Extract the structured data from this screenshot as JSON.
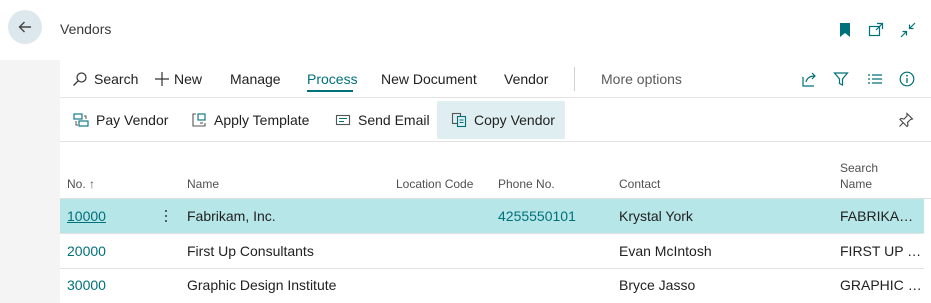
{
  "header": {
    "title": "Vendors"
  },
  "actionbar": {
    "search": "Search",
    "new": "New",
    "manage": "Manage",
    "process": "Process",
    "new_document": "New Document",
    "vendor": "Vendor",
    "more_options": "More options"
  },
  "subbar": {
    "pay_vendor": "Pay Vendor",
    "apply_template": "Apply Template",
    "send_email": "Send Email",
    "copy_vendor": "Copy Vendor"
  },
  "table": {
    "columns": {
      "no": "No. ↑",
      "name": "Name",
      "location_code": "Location Code",
      "phone": "Phone No.",
      "contact": "Contact",
      "search_name_1": "Search",
      "search_name_2": "Name"
    },
    "rows": [
      {
        "no": "10000",
        "name": "Fabrikam, Inc.",
        "location": "",
        "phone": "4255550101",
        "contact": "Krystal York",
        "search": "FABRIKAM, ..."
      },
      {
        "no": "20000",
        "name": "First Up Consultants",
        "location": "",
        "phone": "",
        "contact": "Evan McIntosh",
        "search": "FIRST UP C..."
      },
      {
        "no": "30000",
        "name": "Graphic Design Institute",
        "location": "",
        "phone": "",
        "contact": "Bryce Jasso",
        "search": "GRAPHIC D..."
      }
    ]
  },
  "colors": {
    "accent": "#00707a",
    "selected_row": "#b7e6e8",
    "bookmark": "#00707a"
  },
  "icons": [
    "back-arrow-icon",
    "bookmark-icon",
    "open-new-window-icon",
    "collapse-icon",
    "search-icon",
    "plus-icon",
    "share-icon",
    "filter-icon",
    "list-icon",
    "info-icon",
    "pay-icon",
    "template-icon",
    "email-icon",
    "copy-icon",
    "pin-icon"
  ]
}
